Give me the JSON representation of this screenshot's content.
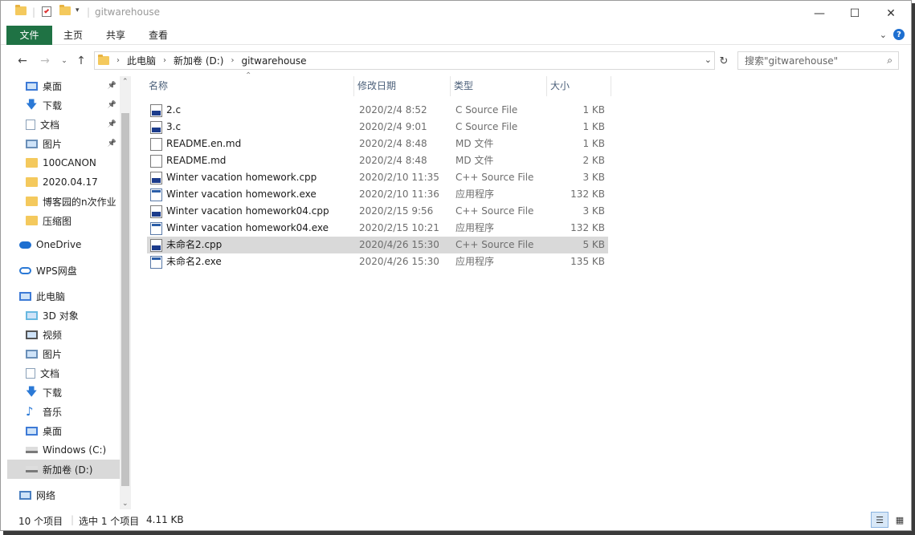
{
  "window": {
    "title": "gitwarehouse"
  },
  "ribbon": {
    "tabs": [
      "文件",
      "主页",
      "共享",
      "查看"
    ]
  },
  "address": {
    "crumbs": [
      "此电脑",
      "新加卷 (D:)",
      "gitwarehouse"
    ]
  },
  "search": {
    "placeholder": "搜索\"gitwarehouse\""
  },
  "nav": {
    "items": [
      {
        "label": "桌面",
        "icon": "desktop-icon",
        "pinned": true
      },
      {
        "label": "下载",
        "icon": "download-icon",
        "pinned": true
      },
      {
        "label": "文档",
        "icon": "document-icon",
        "pinned": true
      },
      {
        "label": "图片",
        "icon": "pictures-icon",
        "pinned": true
      },
      {
        "label": "100CANON",
        "icon": "folder-icon"
      },
      {
        "label": "2020.04.17",
        "icon": "folder-icon"
      },
      {
        "label": "博客园的n次作业",
        "icon": "folder-icon"
      },
      {
        "label": "压缩图",
        "icon": "folder-icon"
      },
      {
        "label": "OneDrive",
        "icon": "onedrive-icon"
      },
      {
        "label": "WPS网盘",
        "icon": "cloud-icon"
      },
      {
        "label": "此电脑",
        "icon": "computer-icon"
      },
      {
        "label": "3D 对象",
        "icon": "3d-objects-icon"
      },
      {
        "label": "视频",
        "icon": "video-icon"
      },
      {
        "label": "图片",
        "icon": "pictures-icon"
      },
      {
        "label": "文档",
        "icon": "document-icon"
      },
      {
        "label": "下载",
        "icon": "download-icon"
      },
      {
        "label": "音乐",
        "icon": "music-icon"
      },
      {
        "label": "桌面",
        "icon": "desktop-icon"
      },
      {
        "label": "Windows (C:)",
        "icon": "drive-icon"
      },
      {
        "label": "新加卷 (D:)",
        "icon": "drive-icon",
        "selected": true
      },
      {
        "label": "网络",
        "icon": "network-icon"
      }
    ]
  },
  "columns": {
    "name": "名称",
    "date": "修改日期",
    "type": "类型",
    "size": "大小"
  },
  "files": [
    {
      "name": "2.c",
      "date": "2020/2/4 8:52",
      "type": "C Source File",
      "size": "1 KB",
      "icon": "c-file-icon"
    },
    {
      "name": "3.c",
      "date": "2020/2/4 9:01",
      "type": "C Source File",
      "size": "1 KB",
      "icon": "c-file-icon"
    },
    {
      "name": "README.en.md",
      "date": "2020/2/4 8:48",
      "type": "MD 文件",
      "size": "1 KB",
      "icon": "text-file-icon"
    },
    {
      "name": "README.md",
      "date": "2020/2/4 8:48",
      "type": "MD 文件",
      "size": "2 KB",
      "icon": "text-file-icon"
    },
    {
      "name": "Winter vacation homework.cpp",
      "date": "2020/2/10 11:35",
      "type": "C++ Source File",
      "size": "3 KB",
      "icon": "cpp-file-icon"
    },
    {
      "name": "Winter vacation homework.exe",
      "date": "2020/2/10 11:36",
      "type": "应用程序",
      "size": "132 KB",
      "icon": "exe-file-icon"
    },
    {
      "name": "Winter vacation homework04.cpp",
      "date": "2020/2/15 9:56",
      "type": "C++ Source File",
      "size": "3 KB",
      "icon": "cpp-file-icon"
    },
    {
      "name": "Winter vacation homework04.exe",
      "date": "2020/2/15 10:21",
      "type": "应用程序",
      "size": "132 KB",
      "icon": "exe-file-icon"
    },
    {
      "name": "未命名2.cpp",
      "date": "2020/4/26 15:30",
      "type": "C++ Source File",
      "size": "5 KB",
      "icon": "cpp-file-icon",
      "selected": true
    },
    {
      "name": "未命名2.exe",
      "date": "2020/4/26 15:30",
      "type": "应用程序",
      "size": "135 KB",
      "icon": "exe-file-icon"
    }
  ],
  "status": {
    "count": "10 个项目",
    "selection": "选中 1 个项目",
    "size": "4.11 KB"
  }
}
